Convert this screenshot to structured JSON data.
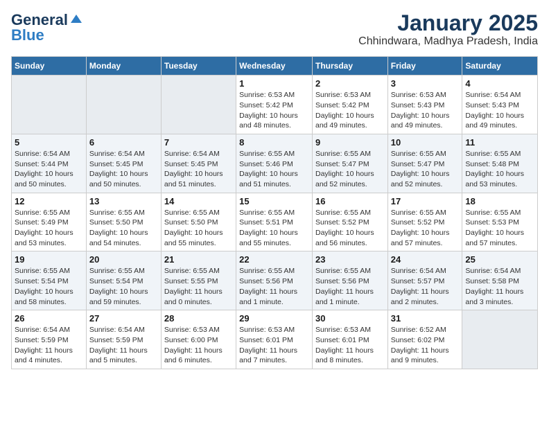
{
  "logo": {
    "line1": "General",
    "line2": "Blue"
  },
  "title": "January 2025",
  "subtitle": "Chhindwara, Madhya Pradesh, India",
  "days_of_week": [
    "Sunday",
    "Monday",
    "Tuesday",
    "Wednesday",
    "Thursday",
    "Friday",
    "Saturday"
  ],
  "weeks": [
    [
      {
        "day": "",
        "info": ""
      },
      {
        "day": "",
        "info": ""
      },
      {
        "day": "",
        "info": ""
      },
      {
        "day": "1",
        "info": "Sunrise: 6:53 AM\nSunset: 5:42 PM\nDaylight: 10 hours\nand 48 minutes."
      },
      {
        "day": "2",
        "info": "Sunrise: 6:53 AM\nSunset: 5:42 PM\nDaylight: 10 hours\nand 49 minutes."
      },
      {
        "day": "3",
        "info": "Sunrise: 6:53 AM\nSunset: 5:43 PM\nDaylight: 10 hours\nand 49 minutes."
      },
      {
        "day": "4",
        "info": "Sunrise: 6:54 AM\nSunset: 5:43 PM\nDaylight: 10 hours\nand 49 minutes."
      }
    ],
    [
      {
        "day": "5",
        "info": "Sunrise: 6:54 AM\nSunset: 5:44 PM\nDaylight: 10 hours\nand 50 minutes."
      },
      {
        "day": "6",
        "info": "Sunrise: 6:54 AM\nSunset: 5:45 PM\nDaylight: 10 hours\nand 50 minutes."
      },
      {
        "day": "7",
        "info": "Sunrise: 6:54 AM\nSunset: 5:45 PM\nDaylight: 10 hours\nand 51 minutes."
      },
      {
        "day": "8",
        "info": "Sunrise: 6:55 AM\nSunset: 5:46 PM\nDaylight: 10 hours\nand 51 minutes."
      },
      {
        "day": "9",
        "info": "Sunrise: 6:55 AM\nSunset: 5:47 PM\nDaylight: 10 hours\nand 52 minutes."
      },
      {
        "day": "10",
        "info": "Sunrise: 6:55 AM\nSunset: 5:47 PM\nDaylight: 10 hours\nand 52 minutes."
      },
      {
        "day": "11",
        "info": "Sunrise: 6:55 AM\nSunset: 5:48 PM\nDaylight: 10 hours\nand 53 minutes."
      }
    ],
    [
      {
        "day": "12",
        "info": "Sunrise: 6:55 AM\nSunset: 5:49 PM\nDaylight: 10 hours\nand 53 minutes."
      },
      {
        "day": "13",
        "info": "Sunrise: 6:55 AM\nSunset: 5:50 PM\nDaylight: 10 hours\nand 54 minutes."
      },
      {
        "day": "14",
        "info": "Sunrise: 6:55 AM\nSunset: 5:50 PM\nDaylight: 10 hours\nand 55 minutes."
      },
      {
        "day": "15",
        "info": "Sunrise: 6:55 AM\nSunset: 5:51 PM\nDaylight: 10 hours\nand 55 minutes."
      },
      {
        "day": "16",
        "info": "Sunrise: 6:55 AM\nSunset: 5:52 PM\nDaylight: 10 hours\nand 56 minutes."
      },
      {
        "day": "17",
        "info": "Sunrise: 6:55 AM\nSunset: 5:52 PM\nDaylight: 10 hours\nand 57 minutes."
      },
      {
        "day": "18",
        "info": "Sunrise: 6:55 AM\nSunset: 5:53 PM\nDaylight: 10 hours\nand 57 minutes."
      }
    ],
    [
      {
        "day": "19",
        "info": "Sunrise: 6:55 AM\nSunset: 5:54 PM\nDaylight: 10 hours\nand 58 minutes."
      },
      {
        "day": "20",
        "info": "Sunrise: 6:55 AM\nSunset: 5:54 PM\nDaylight: 10 hours\nand 59 minutes."
      },
      {
        "day": "21",
        "info": "Sunrise: 6:55 AM\nSunset: 5:55 PM\nDaylight: 11 hours\nand 0 minutes."
      },
      {
        "day": "22",
        "info": "Sunrise: 6:55 AM\nSunset: 5:56 PM\nDaylight: 11 hours\nand 1 minute."
      },
      {
        "day": "23",
        "info": "Sunrise: 6:55 AM\nSunset: 5:56 PM\nDaylight: 11 hours\nand 1 minute."
      },
      {
        "day": "24",
        "info": "Sunrise: 6:54 AM\nSunset: 5:57 PM\nDaylight: 11 hours\nand 2 minutes."
      },
      {
        "day": "25",
        "info": "Sunrise: 6:54 AM\nSunset: 5:58 PM\nDaylight: 11 hours\nand 3 minutes."
      }
    ],
    [
      {
        "day": "26",
        "info": "Sunrise: 6:54 AM\nSunset: 5:59 PM\nDaylight: 11 hours\nand 4 minutes."
      },
      {
        "day": "27",
        "info": "Sunrise: 6:54 AM\nSunset: 5:59 PM\nDaylight: 11 hours\nand 5 minutes."
      },
      {
        "day": "28",
        "info": "Sunrise: 6:53 AM\nSunset: 6:00 PM\nDaylight: 11 hours\nand 6 minutes."
      },
      {
        "day": "29",
        "info": "Sunrise: 6:53 AM\nSunset: 6:01 PM\nDaylight: 11 hours\nand 7 minutes."
      },
      {
        "day": "30",
        "info": "Sunrise: 6:53 AM\nSunset: 6:01 PM\nDaylight: 11 hours\nand 8 minutes."
      },
      {
        "day": "31",
        "info": "Sunrise: 6:52 AM\nSunset: 6:02 PM\nDaylight: 11 hours\nand 9 minutes."
      },
      {
        "day": "",
        "info": ""
      }
    ]
  ]
}
